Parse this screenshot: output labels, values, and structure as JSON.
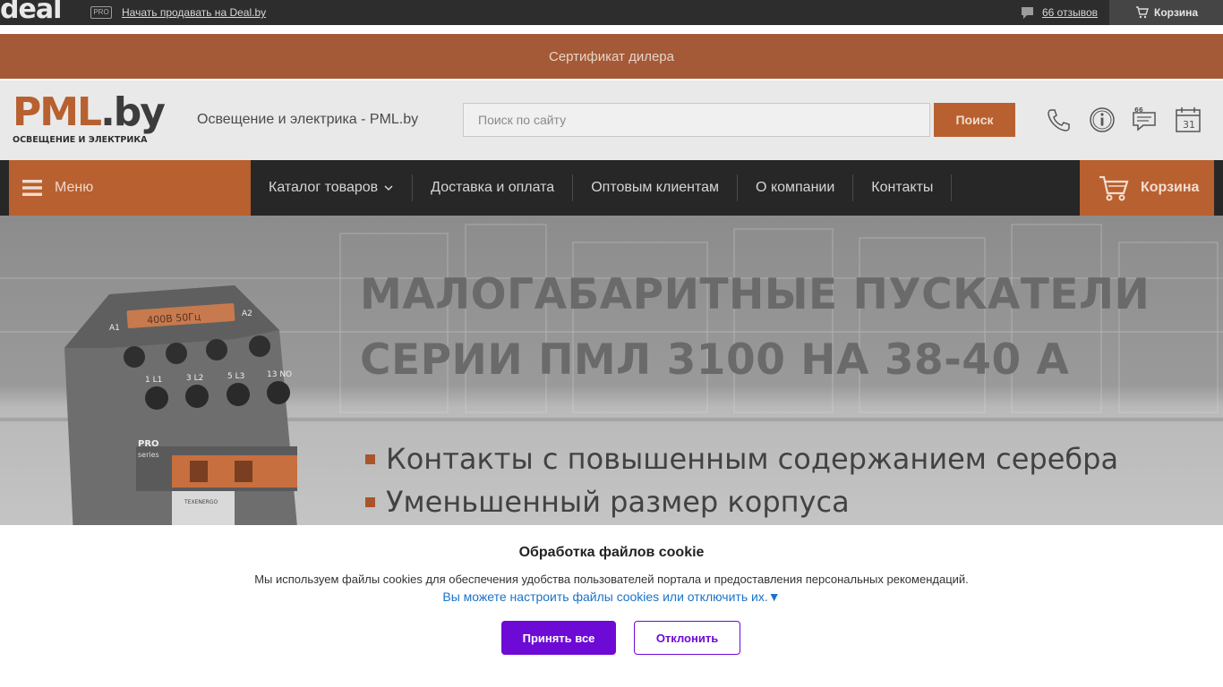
{
  "topbar": {
    "logo_text": "deal",
    "pro_badge": "PRO",
    "sell_link": "Начать продавать на Deal.by",
    "reviews_link": "66 отзывов",
    "cart_label": "Корзина",
    "icons": [
      "comment-icon",
      "cart-icon"
    ]
  },
  "cert_band": {
    "label": "Сертификат дилера"
  },
  "header": {
    "logo_main": "PML",
    "logo_suffix": ".by",
    "logo_sub": "ОСВЕЩЕНИЕ И ЭЛЕКТРИКА",
    "site_title": "Освещение и электрика - PML.by",
    "search_placeholder": "Поиск по сайту",
    "search_button": "Поиск",
    "icons": [
      "phone-icon",
      "info-icon",
      "chat-icon",
      "calendar-icon"
    ],
    "calendar_day": "31"
  },
  "nav": {
    "menu_label": "Меню",
    "items": [
      {
        "label": "Каталог товаров",
        "has_dropdown": true
      },
      {
        "label": "Доставка и оплата"
      },
      {
        "label": "Оптовым клиентам"
      },
      {
        "label": "О компании"
      },
      {
        "label": "Контакты"
      }
    ],
    "cart_label": "Корзина"
  },
  "banner": {
    "headline_line1": "МАЛОГАБАРИТНЫЕ ПУСКАТЕЛИ",
    "headline_line2": "СЕРИИ ПМЛ 3100 НА 38-40 А",
    "bullets": [
      "Контакты с повышенным содержанием серебра",
      "Уменьшенный размер корпуса"
    ],
    "product_labels": {
      "rating": "400В 50Гц",
      "a1": "A1",
      "a2": "A2",
      "t1": "1 L1",
      "t2": "3 L2",
      "t3": "5 L3",
      "t4": "13 NO",
      "series": "PRO",
      "series_sub": "series",
      "brand": "TEXENERGO"
    }
  },
  "cookie": {
    "title": "Обработка файлов cookie",
    "text": "Мы используем файлы cookies для обеспечения удобства пользователей портала и предоставления персональных рекомендаций.",
    "settings_link": "Вы можете настроить файлы cookies или отключить их.",
    "settings_arrow": "▼",
    "accept_button": "Принять все",
    "decline_button": "Отклонить"
  },
  "colors": {
    "accent": "#b8602f",
    "topbar": "#2d2d2d",
    "nav": "#272727",
    "cookie_primary": "#6e0ad6",
    "link": "#1a73c9"
  }
}
